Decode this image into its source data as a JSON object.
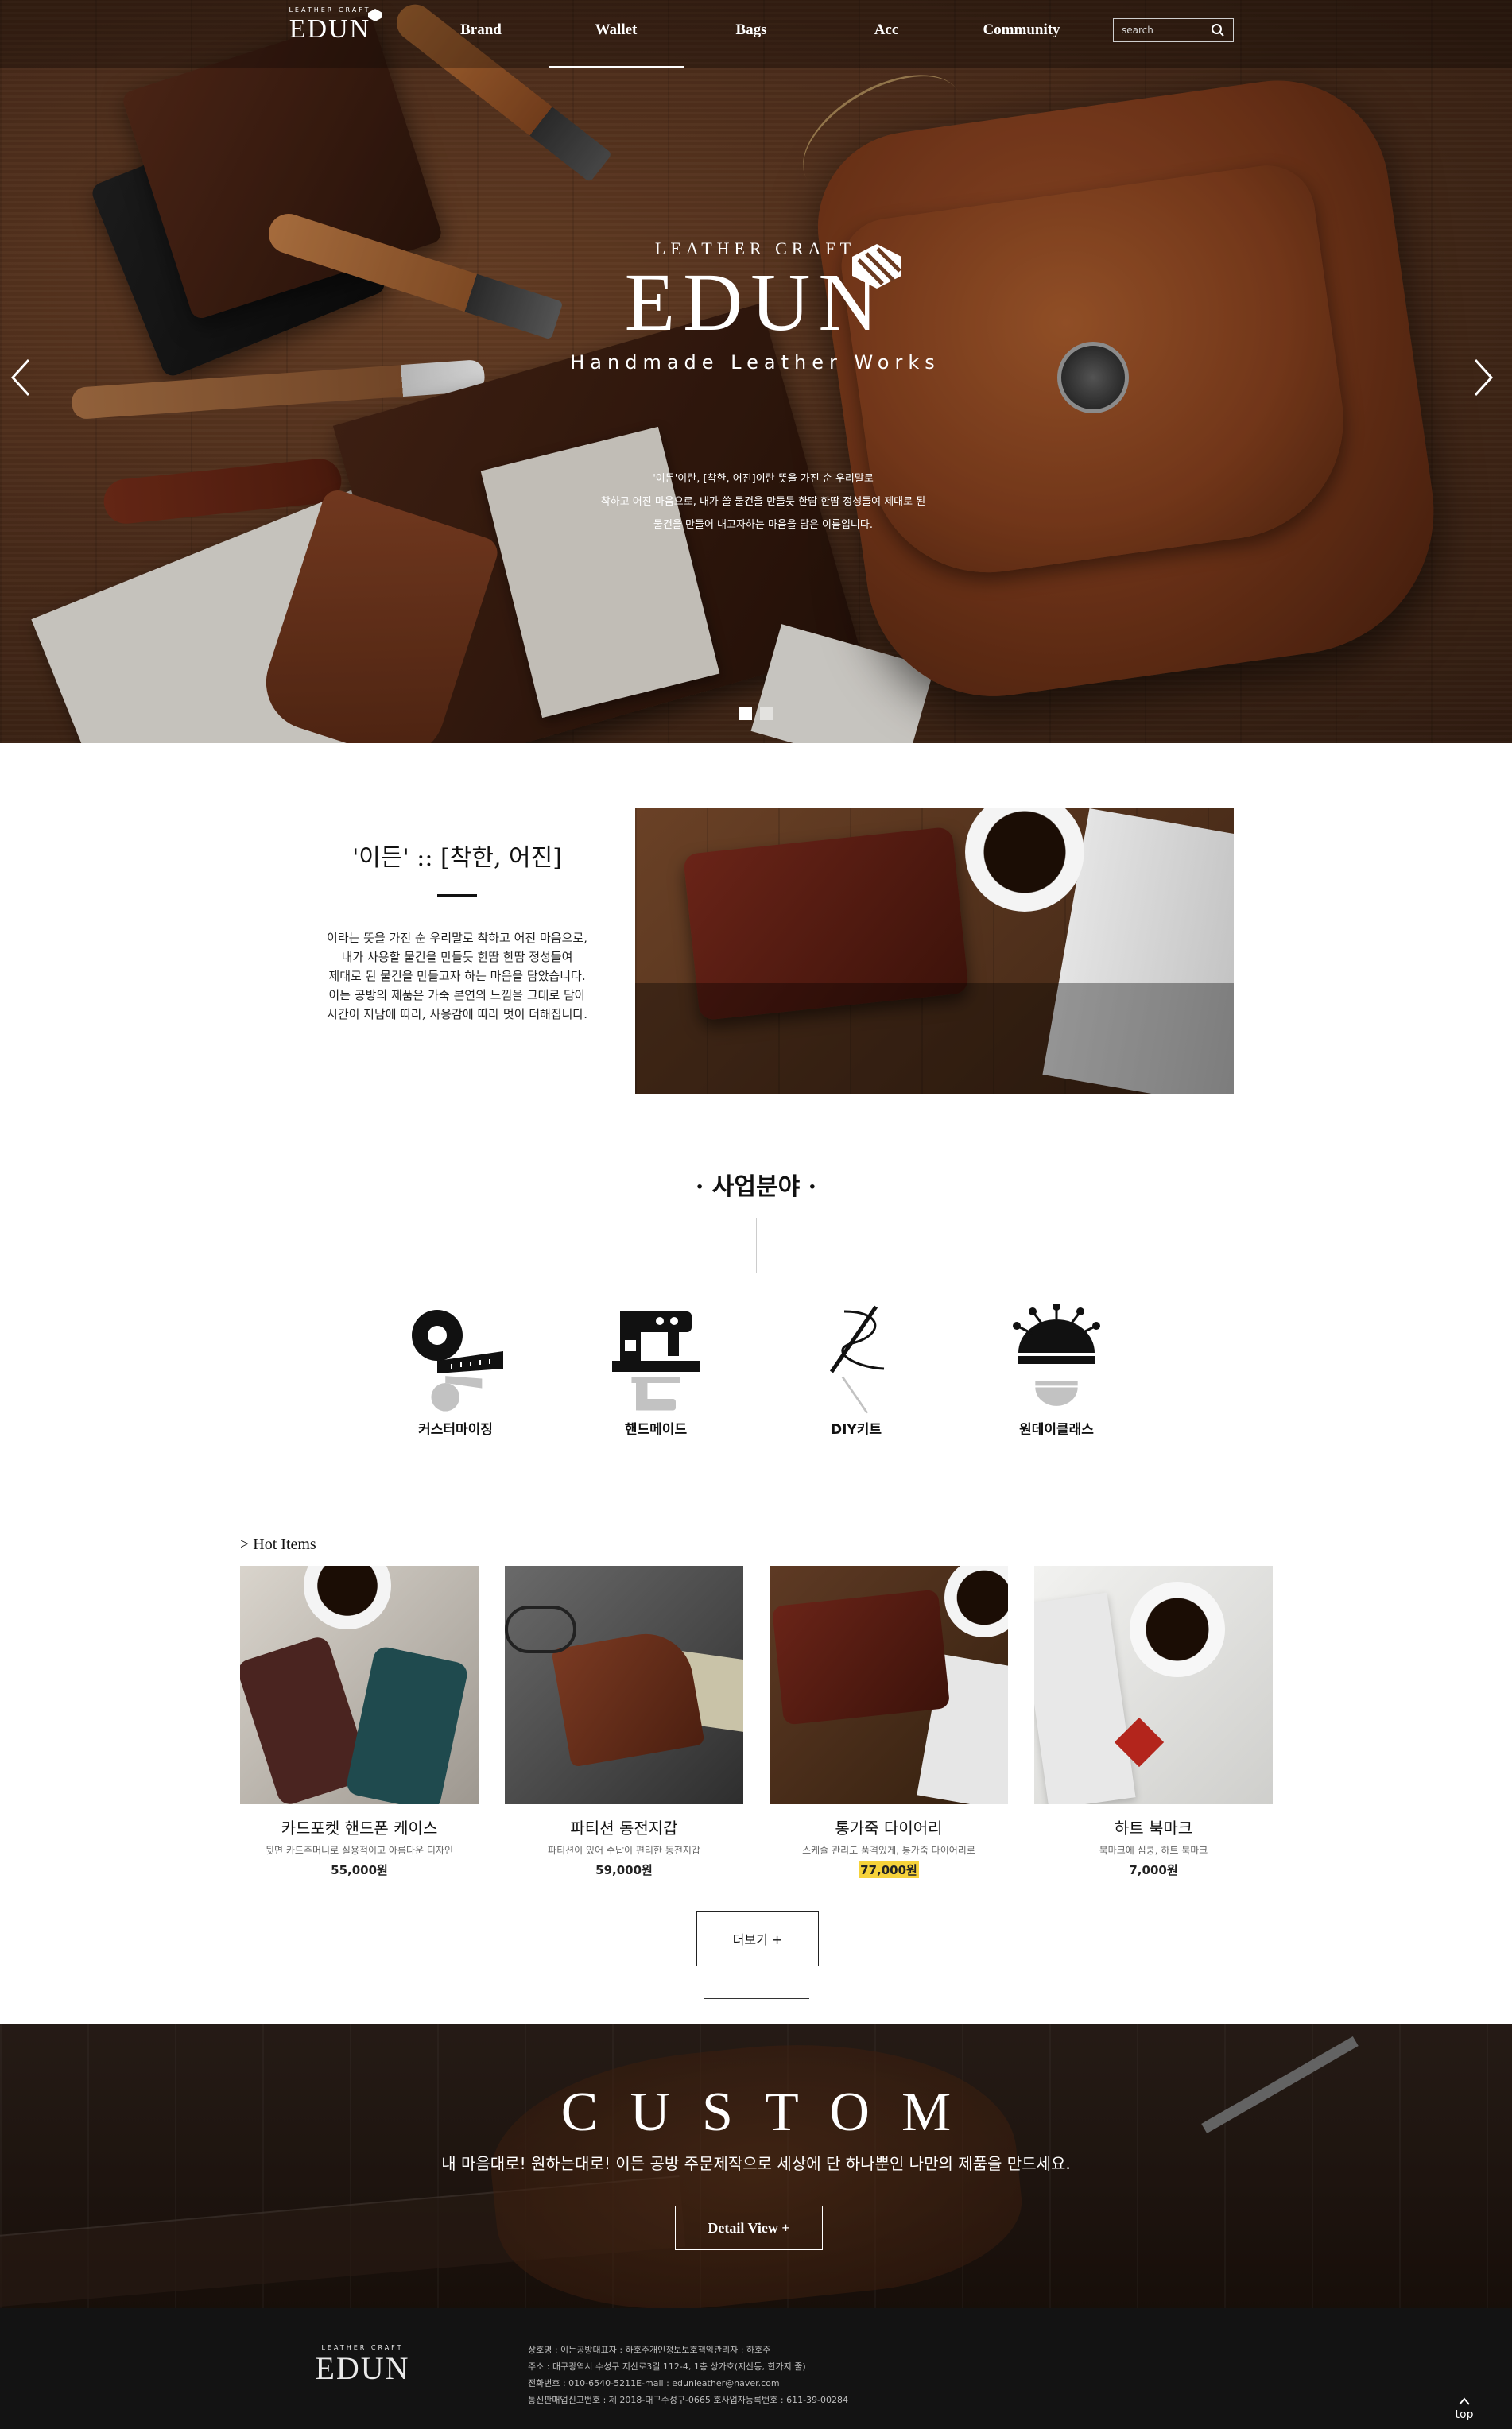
{
  "header": {
    "logo_small": "LEATHER CRAFT",
    "logo_big": "EDUN",
    "nav": [
      {
        "label": "Brand"
      },
      {
        "label": "Wallet"
      },
      {
        "label": "Bags"
      },
      {
        "label": "Acc"
      },
      {
        "label": "Community"
      }
    ],
    "active_nav": "Wallet",
    "search_placeholder": "search"
  },
  "hero": {
    "sub1": "LEATHER CRAFT",
    "brand": "EDUN",
    "sub2": "Handmade Leather Works",
    "desc_lines": [
      "'이든'이란, [착한, 어진]이란 뜻을 가진 순 우리말로",
      "착하고 어진 마음으로, 내가 쓸 물건을 만들듯 한땀 한땀 정성들여 제대로 된",
      "물건을 만들어 내고자하는 마음을 담은 이름입니다."
    ],
    "slide_count": 2,
    "active_slide": 1
  },
  "intro": {
    "title": "'이든' :: [착한, 어진]",
    "lines": [
      "이라는 뜻을 가진 순 우리말로 착하고 어진 마음으로,",
      "내가 사용할 물건을 만들듯 한땀 한땀 정성들여",
      "제대로 된 물건을 만들고자 하는 마음을 담았습니다.",
      "이든 공방의 제품은 가죽 본연의 느낌을 그대로 담아",
      "시간이 지남에 따라, 사용감에 따라 멋이 더해집니다."
    ]
  },
  "business": {
    "title": "· 사업분야 ·",
    "items": [
      {
        "label": "커스터마이징",
        "icon": "tape-measure-icon"
      },
      {
        "label": "핸드메이드",
        "icon": "sewing-machine-icon"
      },
      {
        "label": "DIY키트",
        "icon": "needle-thread-icon"
      },
      {
        "label": "원데이클래스",
        "icon": "pincushion-icon"
      }
    ]
  },
  "hot_items": {
    "title": "> Hot Items",
    "products": [
      {
        "name": "카드포켓 핸드폰 케이스",
        "desc": "뒷면 카드주머니로 실용적이고 아름다운 디자인",
        "price": "55,000원",
        "highlight": false
      },
      {
        "name": "파티션 동전지갑",
        "desc": "파티션이 있어 수납이 편리한 동전지갑",
        "price": "59,000원",
        "highlight": false
      },
      {
        "name": "통가죽 다이어리",
        "desc": "스케쥴 관리도 품격있게, 통가죽 다이어리로",
        "price": "77,000원",
        "highlight": true
      },
      {
        "name": "하트 북마크",
        "desc": "북마크에 심쿵, 하트 북마크",
        "price": "7,000원",
        "highlight": false
      }
    ],
    "more_label": "더보기 +"
  },
  "custom": {
    "title": "CUSTOM",
    "sub": "내 마음대로! 원하는대로! 이든 공방 주문제작으로 세상에 단 하나뿐인 나만의 제품을 만드세요.",
    "button": "Detail View +"
  },
  "footer": {
    "logo_small": "LEATHER CRAFT",
    "logo_big": "EDUN",
    "lines": [
      "상호명 : 이든공방대표자 : 하호주개인정보보호책임관리자 : 하호주",
      "주소 : 대구광역시 수성구 지산로3길 112-4, 1층 상가호(지산동, 한가지 줄)",
      "전화번호 : 010-6540-5211E-mail : edunleather@naver.com",
      "통신판매업신고번호 : 제 2018-대구수성구-0665 호사업자등록번호 : 611-39-00284"
    ],
    "top_label": "top"
  }
}
